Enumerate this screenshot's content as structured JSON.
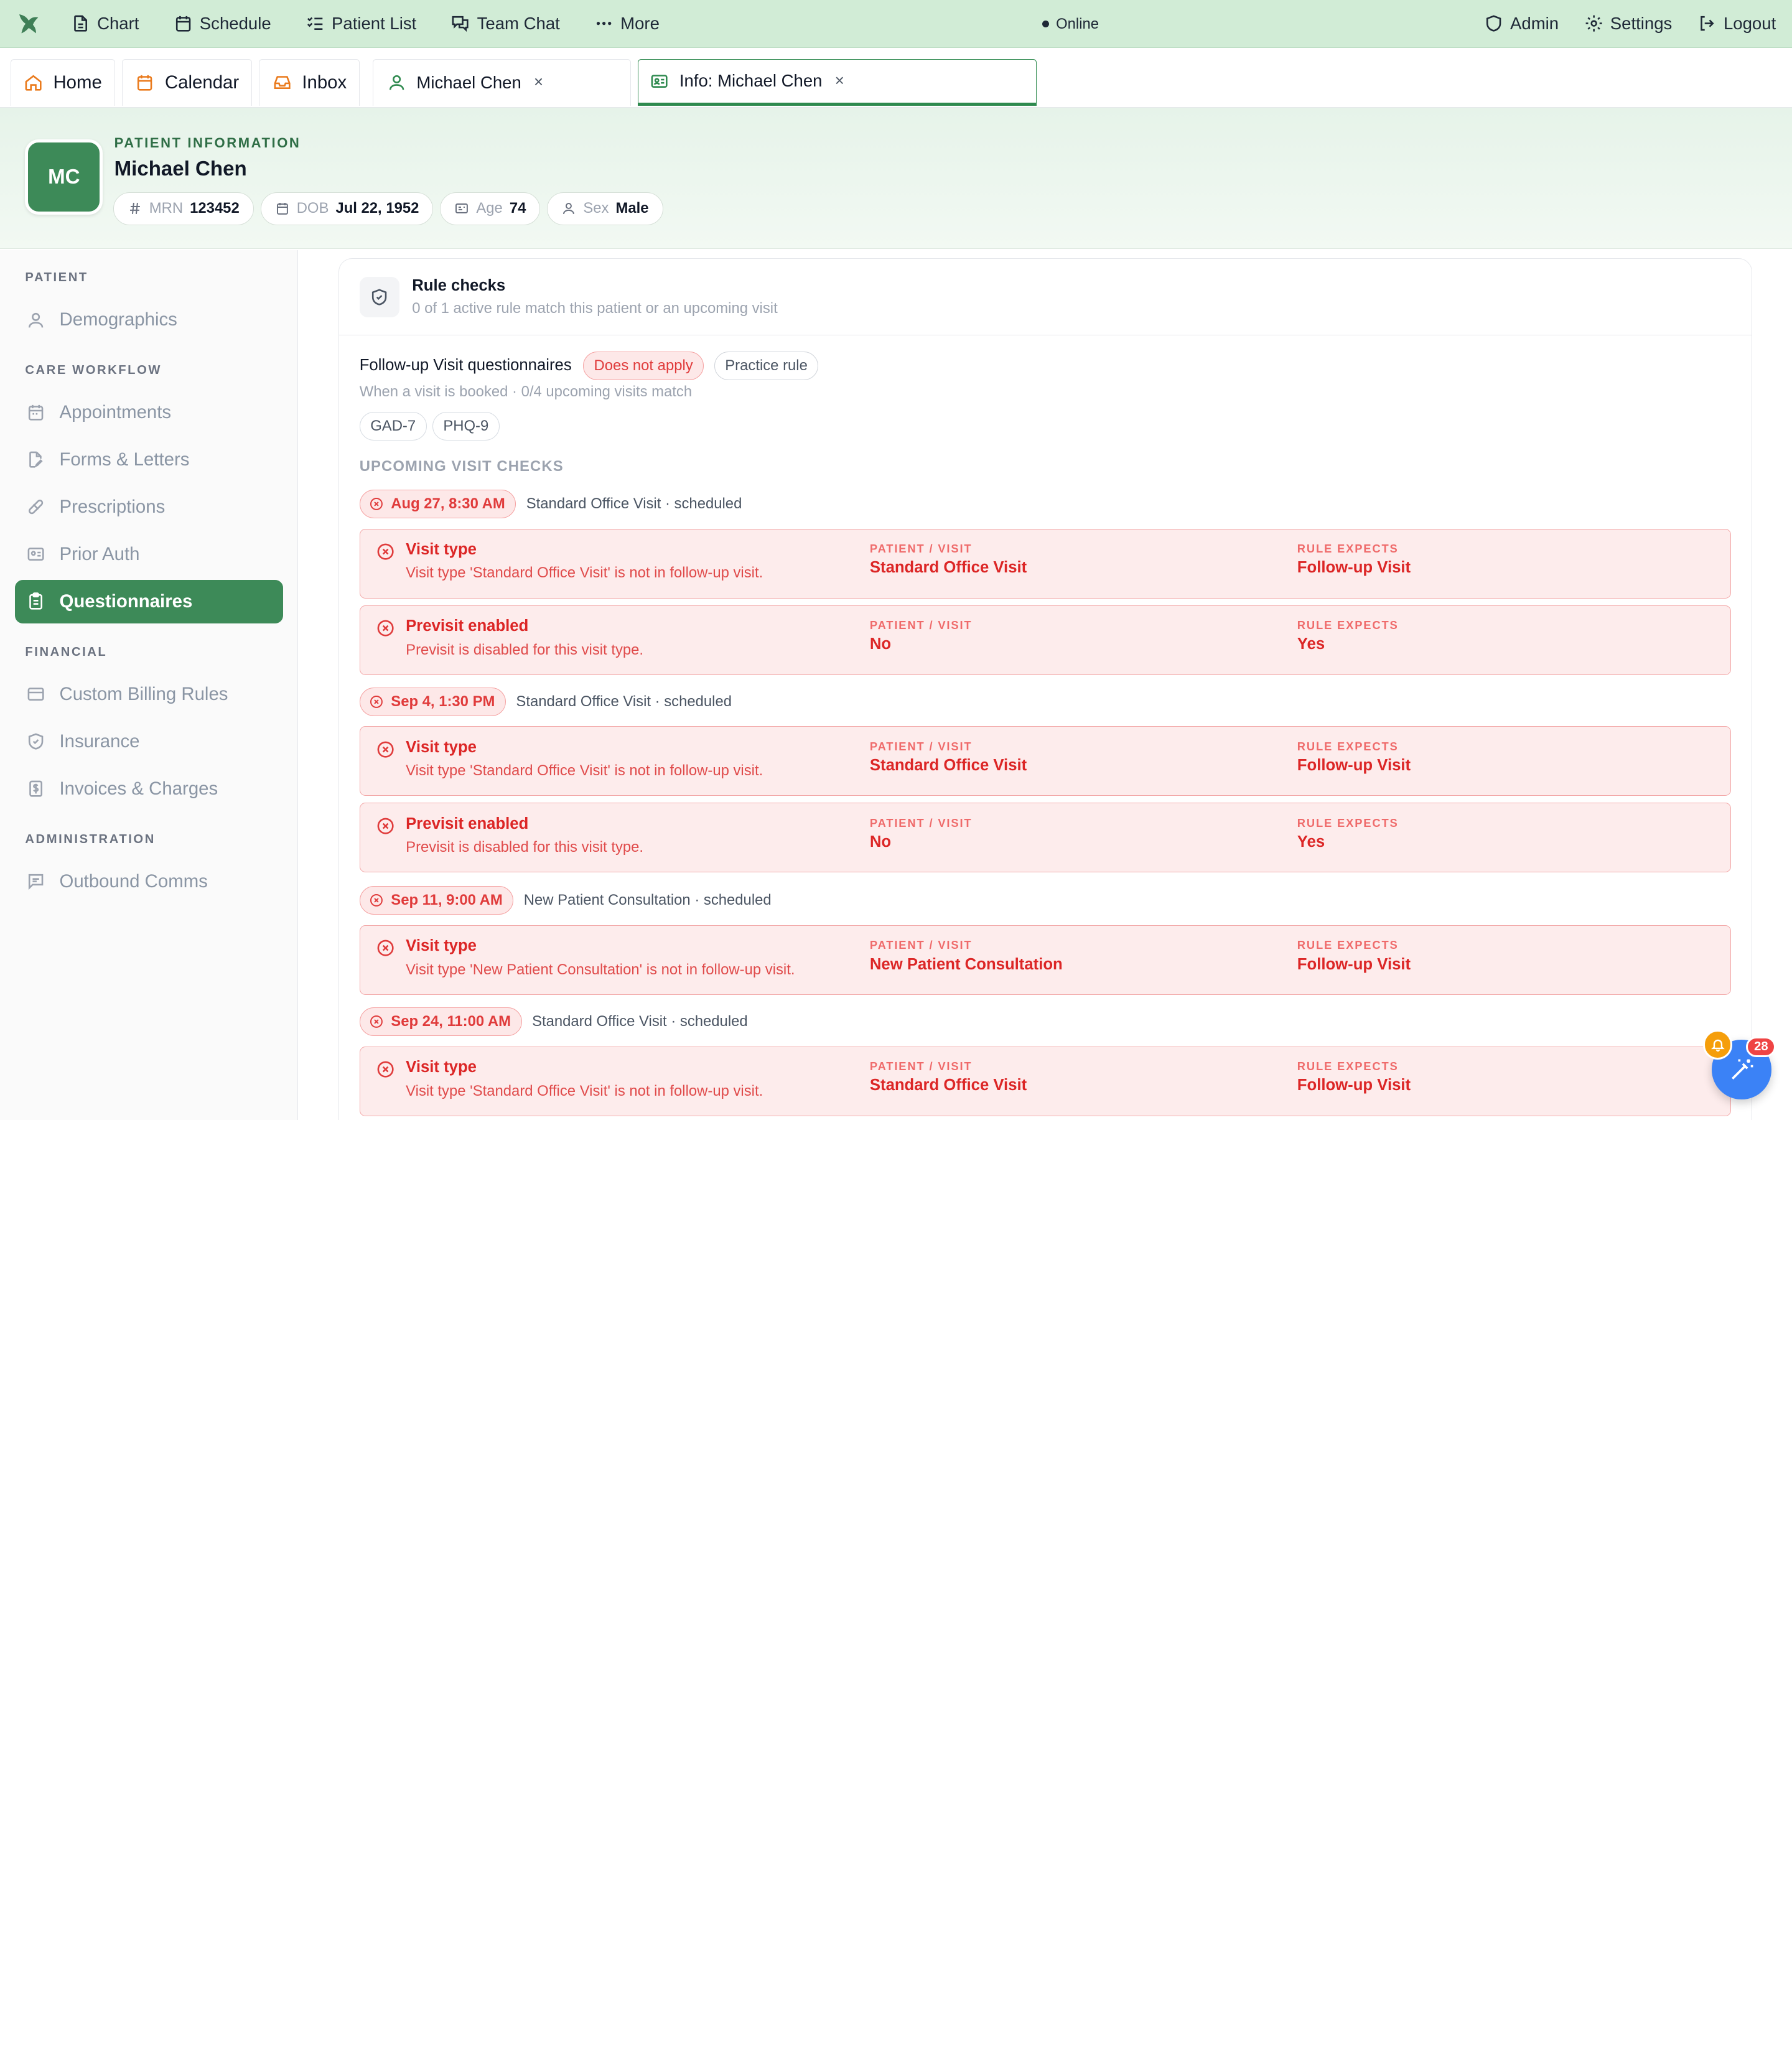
{
  "topnav": {
    "items": [
      {
        "label": "Chart",
        "icon": "document-icon"
      },
      {
        "label": "Schedule",
        "icon": "calendar-icon"
      },
      {
        "label": "Patient List",
        "icon": "checklist-icon"
      },
      {
        "label": "Team Chat",
        "icon": "chat-icon"
      },
      {
        "label": "More",
        "icon": "ellipsis-icon"
      }
    ],
    "status": "Online",
    "right": [
      {
        "label": "Admin",
        "icon": "shield-icon"
      },
      {
        "label": "Settings",
        "icon": "gear-icon"
      },
      {
        "label": "Logout",
        "icon": "logout-icon"
      }
    ]
  },
  "tabs": {
    "home": "Home",
    "calendar": "Calendar",
    "inbox": "Inbox",
    "patient": "Michael Chen",
    "info": "Info: Michael Chen",
    "close": "×"
  },
  "patient": {
    "label": "PATIENT INFORMATION",
    "initials": "MC",
    "name": "Michael Chen",
    "mrn_label": "MRN",
    "mrn": "123452",
    "dob_label": "DOB",
    "dob": "Jul 22, 1952",
    "age_label": "Age",
    "age": "74",
    "sex_label": "Sex",
    "sex": "Male"
  },
  "sidebar": {
    "sections": [
      {
        "title": "PATIENT",
        "items": [
          "Demographics"
        ]
      },
      {
        "title": "CARE WORKFLOW",
        "items": [
          "Appointments",
          "Forms & Letters",
          "Prescriptions",
          "Prior Auth",
          "Questionnaires"
        ]
      },
      {
        "title": "FINANCIAL",
        "items": [
          "Custom Billing Rules",
          "Insurance",
          "Invoices & Charges"
        ]
      },
      {
        "title": "ADMINISTRATION",
        "items": [
          "Outbound Comms"
        ]
      }
    ],
    "active": "Questionnaires"
  },
  "rule_checks": {
    "title": "Rule checks",
    "subtitle": "0 of 1 active rule match this patient or an upcoming visit",
    "rule_name": "Follow-up Visit questionnaires",
    "status_badge": "Does not apply",
    "scope_badge": "Practice rule",
    "description": "When a visit is booked · 0/4 upcoming visits match",
    "tags": [
      "GAD-7",
      "PHQ-9"
    ],
    "section_label": "UPCOMING VISIT CHECKS",
    "col_patient_label": "PATIENT / VISIT",
    "col_rule_label": "RULE EXPECTS",
    "visits": [
      {
        "date": "Aug 27, 8:30 AM",
        "meta": "Standard Office Visit · scheduled",
        "checks": [
          {
            "title": "Visit type",
            "desc": "Visit type 'Standard Office Visit' is not in follow-up visit.",
            "patient": "Standard Office Visit",
            "expects": "Follow-up Visit"
          },
          {
            "title": "Previsit enabled",
            "desc": "Previsit is disabled for this visit type.",
            "patient": "No",
            "expects": "Yes"
          }
        ]
      },
      {
        "date": "Sep 4, 1:30 PM",
        "meta": "Standard Office Visit · scheduled",
        "checks": [
          {
            "title": "Visit type",
            "desc": "Visit type 'Standard Office Visit' is not in follow-up visit.",
            "patient": "Standard Office Visit",
            "expects": "Follow-up Visit"
          },
          {
            "title": "Previsit enabled",
            "desc": "Previsit is disabled for this visit type.",
            "patient": "No",
            "expects": "Yes"
          }
        ]
      },
      {
        "date": "Sep 11, 9:00 AM",
        "meta": "New Patient Consultation · scheduled",
        "checks": [
          {
            "title": "Visit type",
            "desc": "Visit type 'New Patient Consultation' is not in follow-up visit.",
            "patient": "New Patient Consultation",
            "expects": "Follow-up Visit"
          }
        ]
      },
      {
        "date": "Sep 24, 11:00 AM",
        "meta": "Standard Office Visit · scheduled",
        "checks": [
          {
            "title": "Visit type",
            "desc": "Visit type 'Standard Office Visit' is not in follow-up visit.",
            "patient": "Standard Office Visit",
            "expects": "Follow-up Visit"
          }
        ]
      }
    ]
  },
  "floating": {
    "badge_count": "28"
  },
  "colors": {
    "brand_green": "#3d8a58",
    "topbar_bg": "#d1ecd6",
    "error_red": "#dc2626",
    "error_bg": "#fdecec",
    "fab_blue": "#3b82f6",
    "bell_amber": "#f59e0b"
  }
}
